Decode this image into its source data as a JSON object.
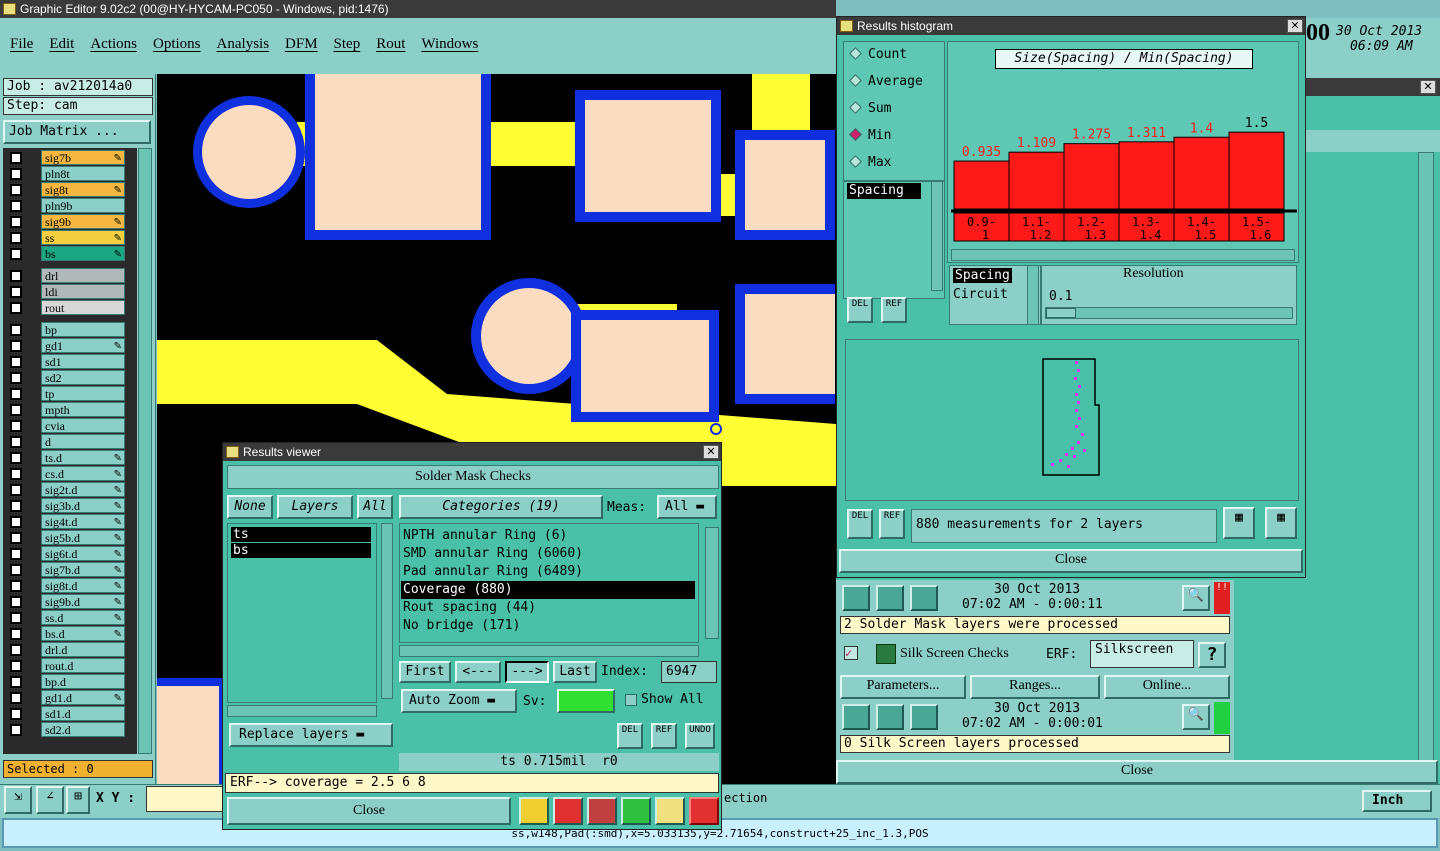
{
  "main": {
    "title": "Graphic Editor 9.02c2 (00@HY-HYCAM-PC050 - Windows, pid:1476)",
    "menu": [
      "File",
      "Edit",
      "Actions",
      "Options",
      "Analysis",
      "DFM",
      "Step",
      "Rout",
      "Windows"
    ],
    "clock_time": "06:09 AM",
    "clock_date": "30 Oct 2013",
    "clock_big": "00",
    "job_label": "Job : av212014a0",
    "step_label": "Step: cam",
    "job_matrix_btn": "Job Matrix ...",
    "selected_label": "Selected : 0",
    "xy_label": "X Y :",
    "status_line": "ss,w148,Pad(:smd),x=5.033135,y=2.71654,construct+25_inc_1.3,POS",
    "units": "Inch",
    "section_label": "ection"
  },
  "layers": [
    {
      "name": "sig7b",
      "color": "#f4b842",
      "edit": true
    },
    {
      "name": "pln8t",
      "color": "#8ccfc8",
      "edit": false
    },
    {
      "name": "sig8t",
      "color": "#f4b842",
      "edit": true
    },
    {
      "name": "pln9b",
      "color": "#8ccfc8",
      "edit": false
    },
    {
      "name": "sig9b",
      "color": "#f4b842",
      "edit": true
    },
    {
      "name": "ss",
      "color": "#f4d040",
      "edit": true
    },
    {
      "name": "bs",
      "color": "#1aa882",
      "edit": true
    },
    {
      "name": "drl",
      "color": "#b0b8b8",
      "edit": false
    },
    {
      "name": "ldi",
      "color": "#b0b8b8",
      "edit": false
    },
    {
      "name": "rout",
      "color": "#d8d8d8",
      "edit": false
    },
    {
      "name": "bp",
      "color": "#8ccfc8",
      "edit": false
    },
    {
      "name": "gd1",
      "color": "#8ccfc8",
      "edit": true
    },
    {
      "name": "sd1",
      "color": "#8ccfc8",
      "edit": false
    },
    {
      "name": "sd2",
      "color": "#8ccfc8",
      "edit": false
    },
    {
      "name": "tp",
      "color": "#8ccfc8",
      "edit": false
    },
    {
      "name": "mpth",
      "color": "#8ccfc8",
      "edit": false
    },
    {
      "name": "cvia",
      "color": "#8ccfc8",
      "edit": false
    },
    {
      "name": "d",
      "color": "#8ccfc8",
      "edit": false
    },
    {
      "name": "ts.d",
      "color": "#8ccfc8",
      "edit": true
    },
    {
      "name": "cs.d",
      "color": "#8ccfc8",
      "edit": true
    },
    {
      "name": "sig2t.d",
      "color": "#8ccfc8",
      "edit": true
    },
    {
      "name": "sig3b.d",
      "color": "#8ccfc8",
      "edit": true
    },
    {
      "name": "sig4t.d",
      "color": "#8ccfc8",
      "edit": true
    },
    {
      "name": "sig5b.d",
      "color": "#8ccfc8",
      "edit": true
    },
    {
      "name": "sig6t.d",
      "color": "#8ccfc8",
      "edit": true
    },
    {
      "name": "sig7b.d",
      "color": "#8ccfc8",
      "edit": true
    },
    {
      "name": "sig8t.d",
      "color": "#8ccfc8",
      "edit": true
    },
    {
      "name": "sig9b.d",
      "color": "#8ccfc8",
      "edit": true
    },
    {
      "name": "ss.d",
      "color": "#8ccfc8",
      "edit": true
    },
    {
      "name": "bs.d",
      "color": "#8ccfc8",
      "edit": true
    },
    {
      "name": "drl.d",
      "color": "#8ccfc8",
      "edit": false
    },
    {
      "name": "rout.d",
      "color": "#8ccfc8",
      "edit": false
    },
    {
      "name": "bp.d",
      "color": "#8ccfc8",
      "edit": false
    },
    {
      "name": "gd1.d",
      "color": "#8ccfc8",
      "edit": true
    },
    {
      "name": "sd1.d",
      "color": "#8ccfc8",
      "edit": false
    },
    {
      "name": "sd2.d",
      "color": "#8ccfc8",
      "edit": false
    }
  ],
  "viewer": {
    "title": "Results viewer",
    "header": "Solder Mask Checks",
    "none_btn": "None",
    "layers_btn": "Layers",
    "all_btn": "All",
    "categories_btn": "Categories (19)",
    "meas_label": "Meas:",
    "meas_value": "All",
    "layers": [
      "ts",
      "bs"
    ],
    "categories": [
      {
        "label": "NPTH annular Ring (6)",
        "selected": false
      },
      {
        "label": "SMD annular Ring (6060)",
        "selected": false
      },
      {
        "label": "Pad annular Ring (6489)",
        "selected": false
      },
      {
        "label": "Coverage (880)",
        "selected": true
      },
      {
        "label": "Rout spacing (44)",
        "selected": false
      },
      {
        "label": "No bridge (171)",
        "selected": false
      }
    ],
    "first_btn": "First",
    "prev_btn": "<---",
    "next_btn": "--->",
    "last_btn": "Last",
    "index_label": "Index:",
    "index_value": "6947",
    "auto_zoom": "Auto Zoom",
    "sv_label": "Sv:",
    "show_all": "Show All",
    "replace_layers": "Replace layers",
    "del_btn": "DEL",
    "ref_btn": "REF",
    "undo_btn": "UNDO",
    "info_line": "ts 0.715mil  r0",
    "erf_line": "ERF--> coverage = 2.5 6 8",
    "close_btn": "Close"
  },
  "histogram": {
    "title": "Results histogram",
    "modes": [
      {
        "label": "Count",
        "on": false
      },
      {
        "label": "Average",
        "on": false
      },
      {
        "label": "Sum",
        "on": false
      },
      {
        "label": "Min",
        "on": true
      },
      {
        "label": "Max",
        "on": false
      }
    ],
    "chart_title": "Size(Spacing) / Min(Spacing)",
    "side_item": "Spacing",
    "spacing_list": [
      "Spacing",
      "Circuit"
    ],
    "resolution_label": "Resolution",
    "resolution_value": "0.1",
    "summary": "880 measurements for 2 layers",
    "close_btn": "Close",
    "del_btn": "DEL",
    "ref_btn": "REF"
  },
  "chart_data": {
    "type": "bar",
    "title": "Size(Spacing) / Min(Spacing)",
    "categories": [
      "0.9-1",
      "1.1-1.2",
      "1.2-1.3",
      "1.3-1.4",
      "1.4-1.5",
      "1.5-1.6"
    ],
    "values": [
      0.935,
      1.109,
      1.275,
      1.311,
      1.4,
      1.5
    ],
    "value_labels": [
      "0.935",
      "1.109",
      "1.275",
      "1.311",
      "1.4",
      "1.5"
    ],
    "bar_color": "#ff1a1a",
    "label_color": "#ff1a1a",
    "ylim": [
      0,
      1.6
    ]
  },
  "jobs": {
    "solder_date": "30 Oct 2013",
    "solder_time": "07:02 AM - 0:00:11",
    "solder_msg": "2 Solder Mask layers were processed",
    "silk_title": "Silk Screen Checks",
    "erf_label": "ERF:",
    "erf_value": "Silkscreen",
    "help_btn": "?",
    "params_btn": "Parameters...",
    "ranges_btn": "Ranges...",
    "online_btn": "Online...",
    "silk_date": "30 Oct 2013",
    "silk_time": "07:02 AM - 0:00:01",
    "silk_msg": "0 Silk Screen layers processed",
    "close_btn": "Close"
  }
}
